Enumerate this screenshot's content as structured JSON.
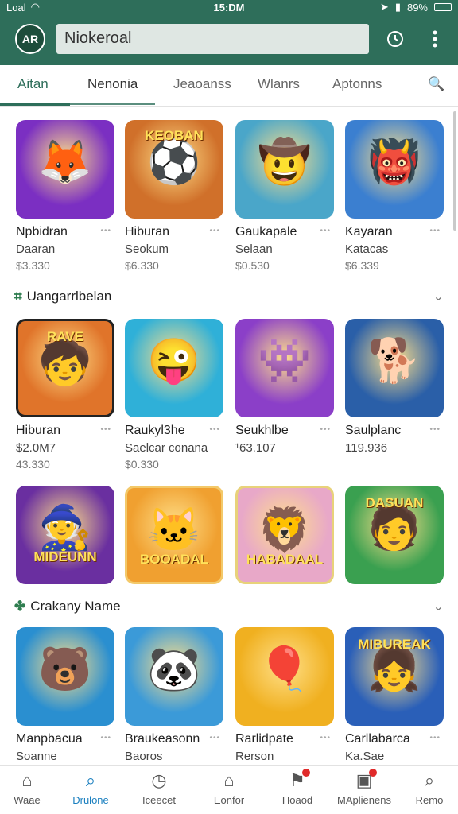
{
  "status": {
    "carrier": "Loal",
    "time": "15:DM",
    "battery": "89%"
  },
  "header": {
    "avatar": "AR",
    "search_value": "Niokeroal"
  },
  "tabs": [
    {
      "label": "Aitan"
    },
    {
      "label": "Nenonia"
    },
    {
      "label": "Jeaoanss"
    },
    {
      "label": "Wlanrs"
    },
    {
      "label": "Aptonns"
    }
  ],
  "rows": [
    [
      {
        "name": "Npbidran",
        "sub": "Daaran",
        "price": "$3.330",
        "icon": "puzzle-hero-icon",
        "bg": "#7b2fc2",
        "glyph": "🦊"
      },
      {
        "name": "Hiburan",
        "sub": "Seokum",
        "price": "$6.330",
        "icon": "soccer-icon",
        "bg": "#d0702a",
        "glyph": "⚽",
        "banner": "KEOBAN"
      },
      {
        "name": "Gaukapale",
        "sub": "Selaan",
        "price": "$0.530",
        "icon": "team-icon",
        "bg": "#4aa6c9",
        "glyph": "🤠"
      },
      {
        "name": "Kayaran",
        "sub": "Katacas",
        "price": "$6.339",
        "icon": "monster-icon",
        "bg": "#3b7fd0",
        "glyph": "👹"
      }
    ],
    [
      {
        "name": "Hiburan",
        "sub": "$2.0M7",
        "price": "43.330",
        "icon": "kids-icon",
        "bg": "#e0742a",
        "glyph": "🧒",
        "banner": "RAVE"
      },
      {
        "name": "Raukyl3he",
        "sub": "Saelcar conana",
        "price": "$0.330",
        "icon": "candy-face-icon",
        "bg": "#2fb0d8",
        "glyph": "😜"
      },
      {
        "name": "Seukhlbe",
        "sub": "¹63.107",
        "price": "",
        "icon": "jewel-monster-icon",
        "bg": "#8b3fc8",
        "glyph": "👾"
      },
      {
        "name": "Saulplanc",
        "sub": "119.936",
        "price": "",
        "icon": "dog-soccer-icon",
        "bg": "#2a5fa8",
        "glyph": "🐕"
      }
    ],
    [
      {
        "name": "",
        "sub": "",
        "price": "",
        "icon": "hat-hero-icon",
        "bg": "#6a2fa0",
        "glyph": "🧙",
        "banner": "MIDEUNN"
      },
      {
        "name": "",
        "sub": "",
        "price": "",
        "icon": "wizard-cat-icon",
        "bg": "#f0a030",
        "glyph": "🐱",
        "banner": "BOOADAL"
      },
      {
        "name": "",
        "sub": "",
        "price": "",
        "icon": "lion-icon",
        "bg": "#e8a8c8",
        "glyph": "🦁",
        "banner": "HABADAAL"
      },
      {
        "name": "",
        "sub": "",
        "price": "",
        "icon": "forest-icon",
        "bg": "#3aa050",
        "glyph": "🧑",
        "banner": "DASUAN"
      }
    ],
    [
      {
        "name": "Manpbacua",
        "sub": "Soanne",
        "price": "",
        "icon": "bear-soccer-icon",
        "bg": "#2a8fd0",
        "glyph": "🐻"
      },
      {
        "name": "Braukeasonn",
        "sub": "Baoros",
        "price": "",
        "icon": "panda-hat-icon",
        "bg": "#3b9ad8",
        "glyph": "🐼"
      },
      {
        "name": "Rarlidpate",
        "sub": "Rerson",
        "price": "",
        "icon": "balloon-icon",
        "bg": "#f0b020",
        "glyph": "🎈"
      },
      {
        "name": "Carllabarca",
        "sub": "Ka.Sae",
        "price": "",
        "icon": "girl-hero-icon",
        "bg": "#2a5fb8",
        "glyph": "👧",
        "banner": "MIBUREAK"
      }
    ]
  ],
  "sections": [
    {
      "title": "Uangarrlbelan"
    },
    {
      "title": "Crakany Name"
    }
  ],
  "nav": [
    {
      "label": "Waae",
      "icon": "home-icon",
      "glyph": "⌂"
    },
    {
      "label": "Drulone",
      "icon": "search-icon",
      "glyph": "⌕"
    },
    {
      "label": "Iceecet",
      "icon": "clock-icon",
      "glyph": "◷"
    },
    {
      "label": "Eonfor",
      "icon": "store-icon",
      "glyph": "⌂"
    },
    {
      "label": "Hoaod",
      "icon": "game-icon",
      "glyph": "⚑"
    },
    {
      "label": "MAplienens",
      "icon": "apps-icon",
      "glyph": "▣"
    },
    {
      "label": "Remo",
      "icon": "profile-search-icon",
      "glyph": "⌕"
    }
  ]
}
